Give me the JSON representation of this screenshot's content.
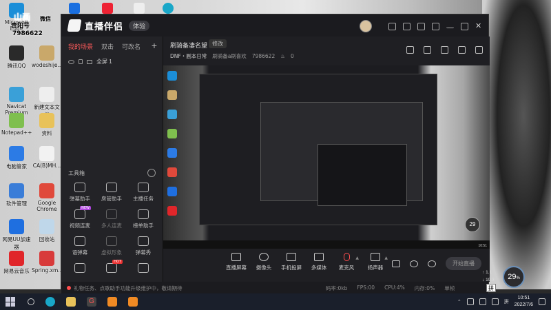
{
  "desktop": {
    "icons": [
      {
        "label": "Microsoft Edge",
        "color": "#1b8ed8"
      },
      {
        "label": "腾讯QQ",
        "color": "#2a2a2a"
      },
      {
        "label": "wodeshije...",
        "color": "#c9a86a"
      },
      {
        "label": "Navicat Premium 11",
        "color": "#3aa0d8"
      },
      {
        "label": "新建文本文档",
        "color": "#eeeeee"
      },
      {
        "label": "Notepad++",
        "color": "#7fbf4e"
      },
      {
        "label": "资料",
        "color": "#e8c25a"
      },
      {
        "label": "电脑管家",
        "color": "#2c7be5"
      },
      {
        "label": "CA(B)MH...",
        "color": "#f2f2f2"
      },
      {
        "label": "软件管理",
        "color": "#3a7dd8"
      },
      {
        "label": "Google Chrome",
        "color": "#e0493b"
      },
      {
        "label": "网易UU加速器",
        "color": "#1f6fe0"
      },
      {
        "label": "回收站",
        "color": "#bfd7ea"
      },
      {
        "label": "网易云音乐",
        "color": "#e0262a"
      },
      {
        "label": "Spring.xm...",
        "color": "#d83b3b"
      }
    ],
    "overlay_text": [
      "山画",
      "贵阳号",
      "7986622",
      "微信"
    ]
  },
  "app": {
    "name": "直播伴侣",
    "version_badge": "体验",
    "left_tabs": [
      "我的场景",
      "双击",
      "可改名"
    ],
    "add_label": "+",
    "scene_item": "全屏 1",
    "tools_title": "工具箱",
    "tools": [
      {
        "label": "弹幕助手",
        "dim": false,
        "tag": ""
      },
      {
        "label": "房管助手",
        "dim": false,
        "tag": ""
      },
      {
        "label": "主播任务",
        "dim": false,
        "tag": ""
      },
      {
        "label": "视频连麦",
        "dim": false,
        "tag": "NEW"
      },
      {
        "label": "多人连麦",
        "dim": true,
        "tag": ""
      },
      {
        "label": "榜单助手",
        "dim": false,
        "tag": ""
      },
      {
        "label": "语弹幕",
        "dim": false,
        "tag": ""
      },
      {
        "label": "虚拟形象",
        "dim": true,
        "tag": ""
      },
      {
        "label": "弹幕秀",
        "dim": false,
        "tag": ""
      },
      {
        "label": "",
        "dim": false,
        "tag": ""
      },
      {
        "label": "",
        "dim": false,
        "tag": "HOT"
      },
      {
        "label": "",
        "dim": false,
        "tag": ""
      }
    ],
    "room": {
      "title": "刷骑备凄名望",
      "edit_label": "修改",
      "category": "DNF・副本日常",
      "account": "刷骑备a刷喜欢",
      "room_id": "7986622",
      "likes": "0"
    },
    "controls": [
      {
        "label": "直播屏幕"
      },
      {
        "label": "摄像头"
      },
      {
        "label": "手机投屏"
      },
      {
        "label": "多媒体"
      },
      {
        "label": "麦克风"
      },
      {
        "label": "扬声器"
      }
    ],
    "start_label": "开始直播",
    "status": {
      "notice": "礼物任务、点歌助手功能升级维护中，敬请期待",
      "bitrate": "码率:0kb",
      "fps": "FPS:00",
      "cpu": "CPU:4%",
      "mem": "内存:0%",
      "extra": "单帧"
    }
  },
  "preview": {
    "perf_value": "29"
  },
  "perf_widget": {
    "value": "29",
    "unit": "%",
    "up": "1.1",
    "down": "19.3",
    "ime": "拼"
  },
  "taskbar": {
    "time": "10:51",
    "date": "2022/7/6"
  }
}
